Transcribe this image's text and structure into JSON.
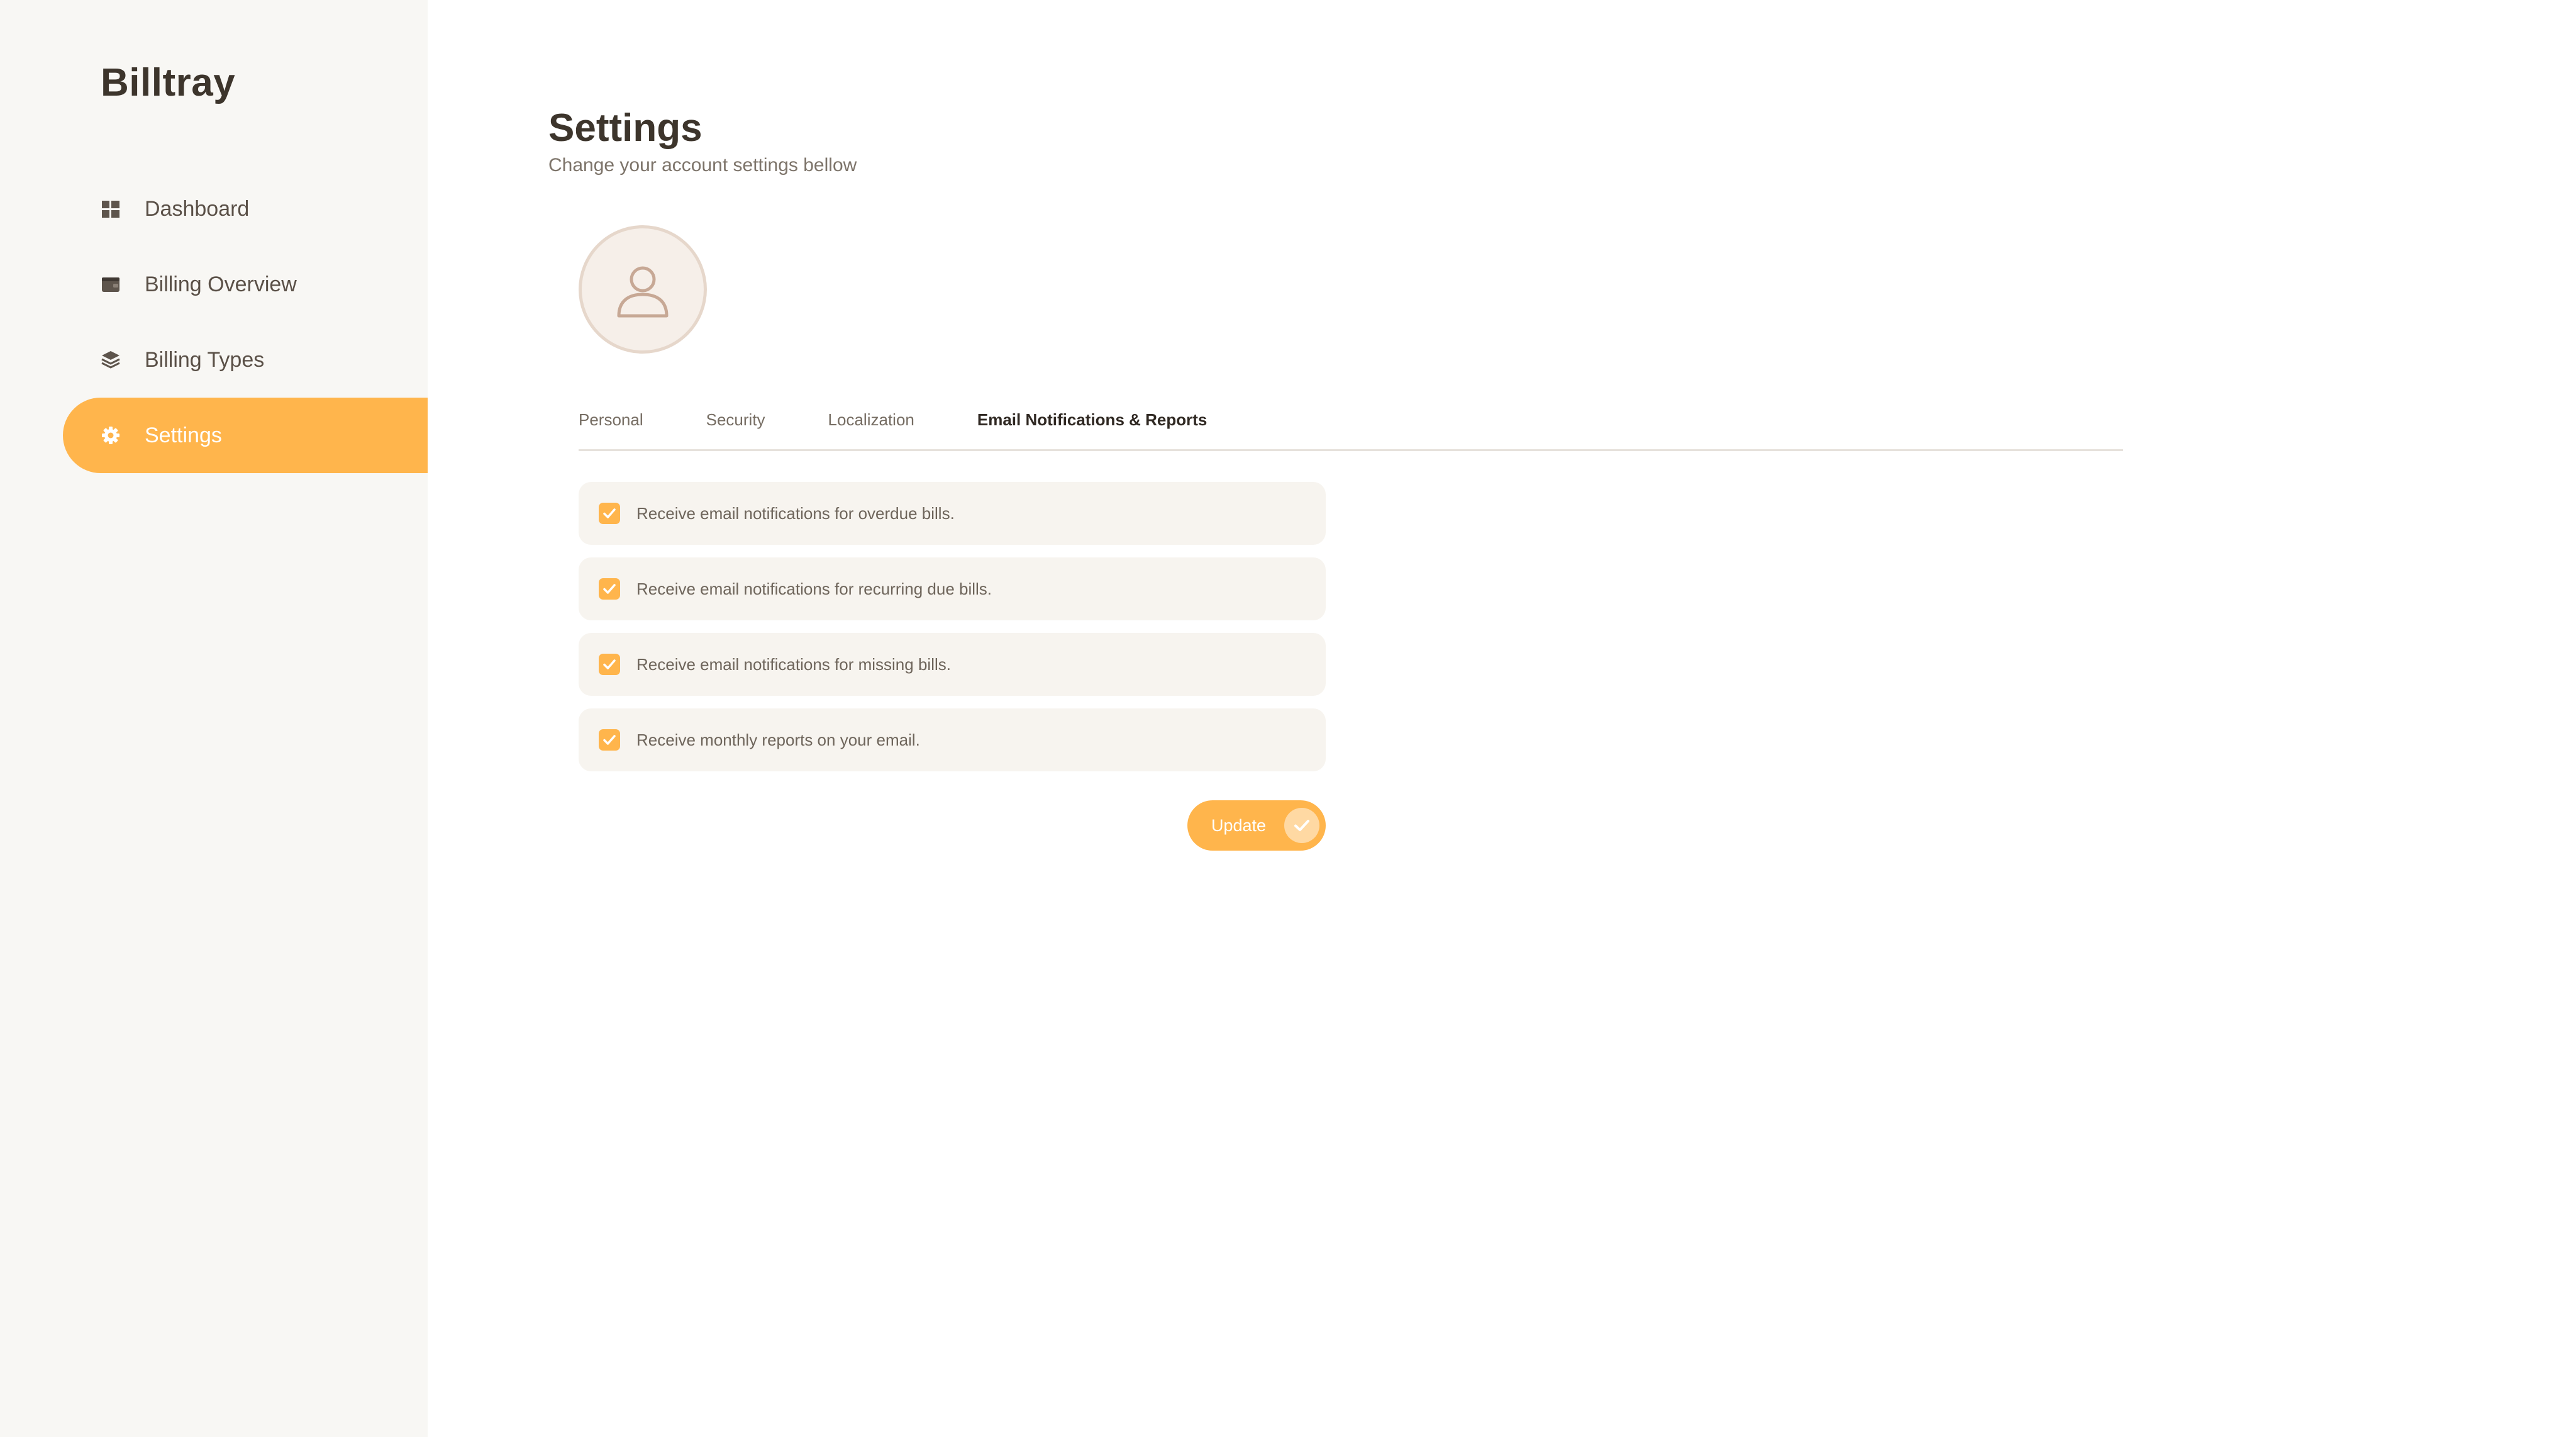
{
  "app": {
    "brand": "Billtray"
  },
  "sidebar": {
    "items": [
      {
        "label": "Dashboard",
        "icon": "grid-icon",
        "active": false
      },
      {
        "label": "Billing Overview",
        "icon": "wallet-icon",
        "active": false
      },
      {
        "label": "Billing Types",
        "icon": "layers-icon",
        "active": false
      },
      {
        "label": "Settings",
        "icon": "gear-icon",
        "active": true
      }
    ]
  },
  "page": {
    "title": "Settings",
    "subtitle": "Change your account settings bellow"
  },
  "avatar": {
    "icon": "user-icon"
  },
  "tabs": [
    {
      "label": "Personal",
      "active": false
    },
    {
      "label": "Security",
      "active": false
    },
    {
      "label": "Localization",
      "active": false
    },
    {
      "label": "Email Notifications & Reports",
      "active": true
    }
  ],
  "options": [
    {
      "label": "Receive email notifications for overdue bills.",
      "checked": true
    },
    {
      "label": "Receive email notifications for recurring due bills.",
      "checked": true
    },
    {
      "label": "Receive email notifications for missing bills.",
      "checked": true
    },
    {
      "label": "Receive monthly reports on your email.",
      "checked": true
    }
  ],
  "actions": {
    "update_label": "Update",
    "update_icon": "check-icon"
  },
  "colors": {
    "accent": "#ffb54c",
    "sidebar_bg": "#f8f7f4",
    "text_dark": "#3d352c"
  }
}
